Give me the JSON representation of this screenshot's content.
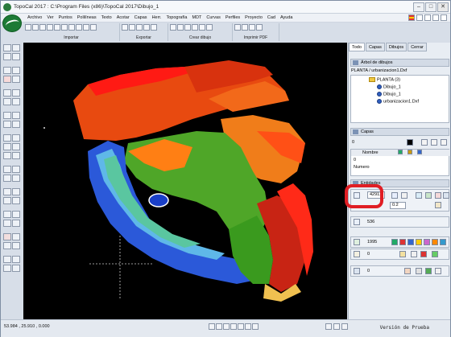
{
  "window": {
    "title": "TopoCal 2017 : C:\\Program Files (x86)\\TopoCal 2017\\Dibujo_1",
    "controls": [
      "–",
      "□",
      "✕"
    ]
  },
  "menu": {
    "items": [
      "Archivo",
      "Ver",
      "Puntos",
      "Polilíneas",
      "Texto",
      "Acotar",
      "Capas",
      "Herr.",
      "Topografía",
      "MDT",
      "Curvas",
      "Perfiles",
      "Proyecto",
      "Cad",
      "Ayuda"
    ]
  },
  "toolbar": {
    "groups": [
      "Importar",
      "Exportar",
      "Crear dibujo",
      "Imprimir PDF"
    ]
  },
  "panel": {
    "tabs": [
      "Todo",
      "Capas",
      "Dibujos",
      "Cerrar"
    ],
    "tree_header": "Árbol de dibujos",
    "tree_path": "PLANTA / urbanizacion1.Dxf",
    "tree_items": [
      "PLANTA (3)",
      "Dibujo_1",
      "Dibujo_1",
      "urbanizacion1.Dxf"
    ],
    "layers_header": "Capas",
    "layers_value": "0",
    "layers_column": "Nombre",
    "layers_rows": [
      "0",
      "Numero"
    ],
    "entities_header": "Entidades",
    "entities": [
      {
        "value": "42911",
        "combo": "0.2"
      },
      {
        "value": "536",
        "combo": ""
      },
      {
        "value": "1995",
        "combo": ""
      },
      {
        "value": "0",
        "combo": ""
      },
      {
        "value": "0",
        "combo": ""
      }
    ]
  },
  "status": {
    "coords": "53.984 , 25.910 , 0.000",
    "version": "Versión de Prueba"
  },
  "colors": {
    "highlight_ring": "#e01e24",
    "canvas_bg": "#000000",
    "terrain_red": "#d42b10",
    "terrain_orange": "#f07d1a",
    "terrain_green": "#3a9a1e",
    "terrain_blue": "#2b59d9"
  }
}
